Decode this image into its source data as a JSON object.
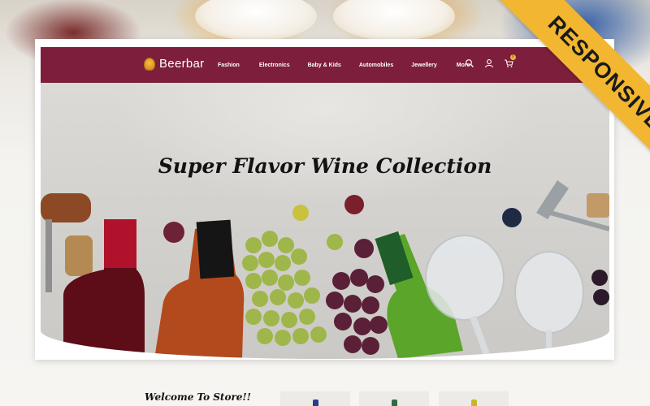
{
  "site": {
    "logo_text": "Beerbar"
  },
  "nav": {
    "menu": [
      "Fashion",
      "Electronics",
      "Baby & Kids",
      "Automobiles",
      "Jewellery",
      "More"
    ],
    "icons": [
      "search-icon",
      "user-icon",
      "cart-icon"
    ],
    "cart_count": "0",
    "background": "#7d1e3c"
  },
  "hero": {
    "title": "Super Flavor Wine Collection"
  },
  "badge": {
    "text": "RESPONSIVE",
    "color": "#f2b630"
  },
  "section": {
    "welcome": "Welcome To Store!!"
  }
}
